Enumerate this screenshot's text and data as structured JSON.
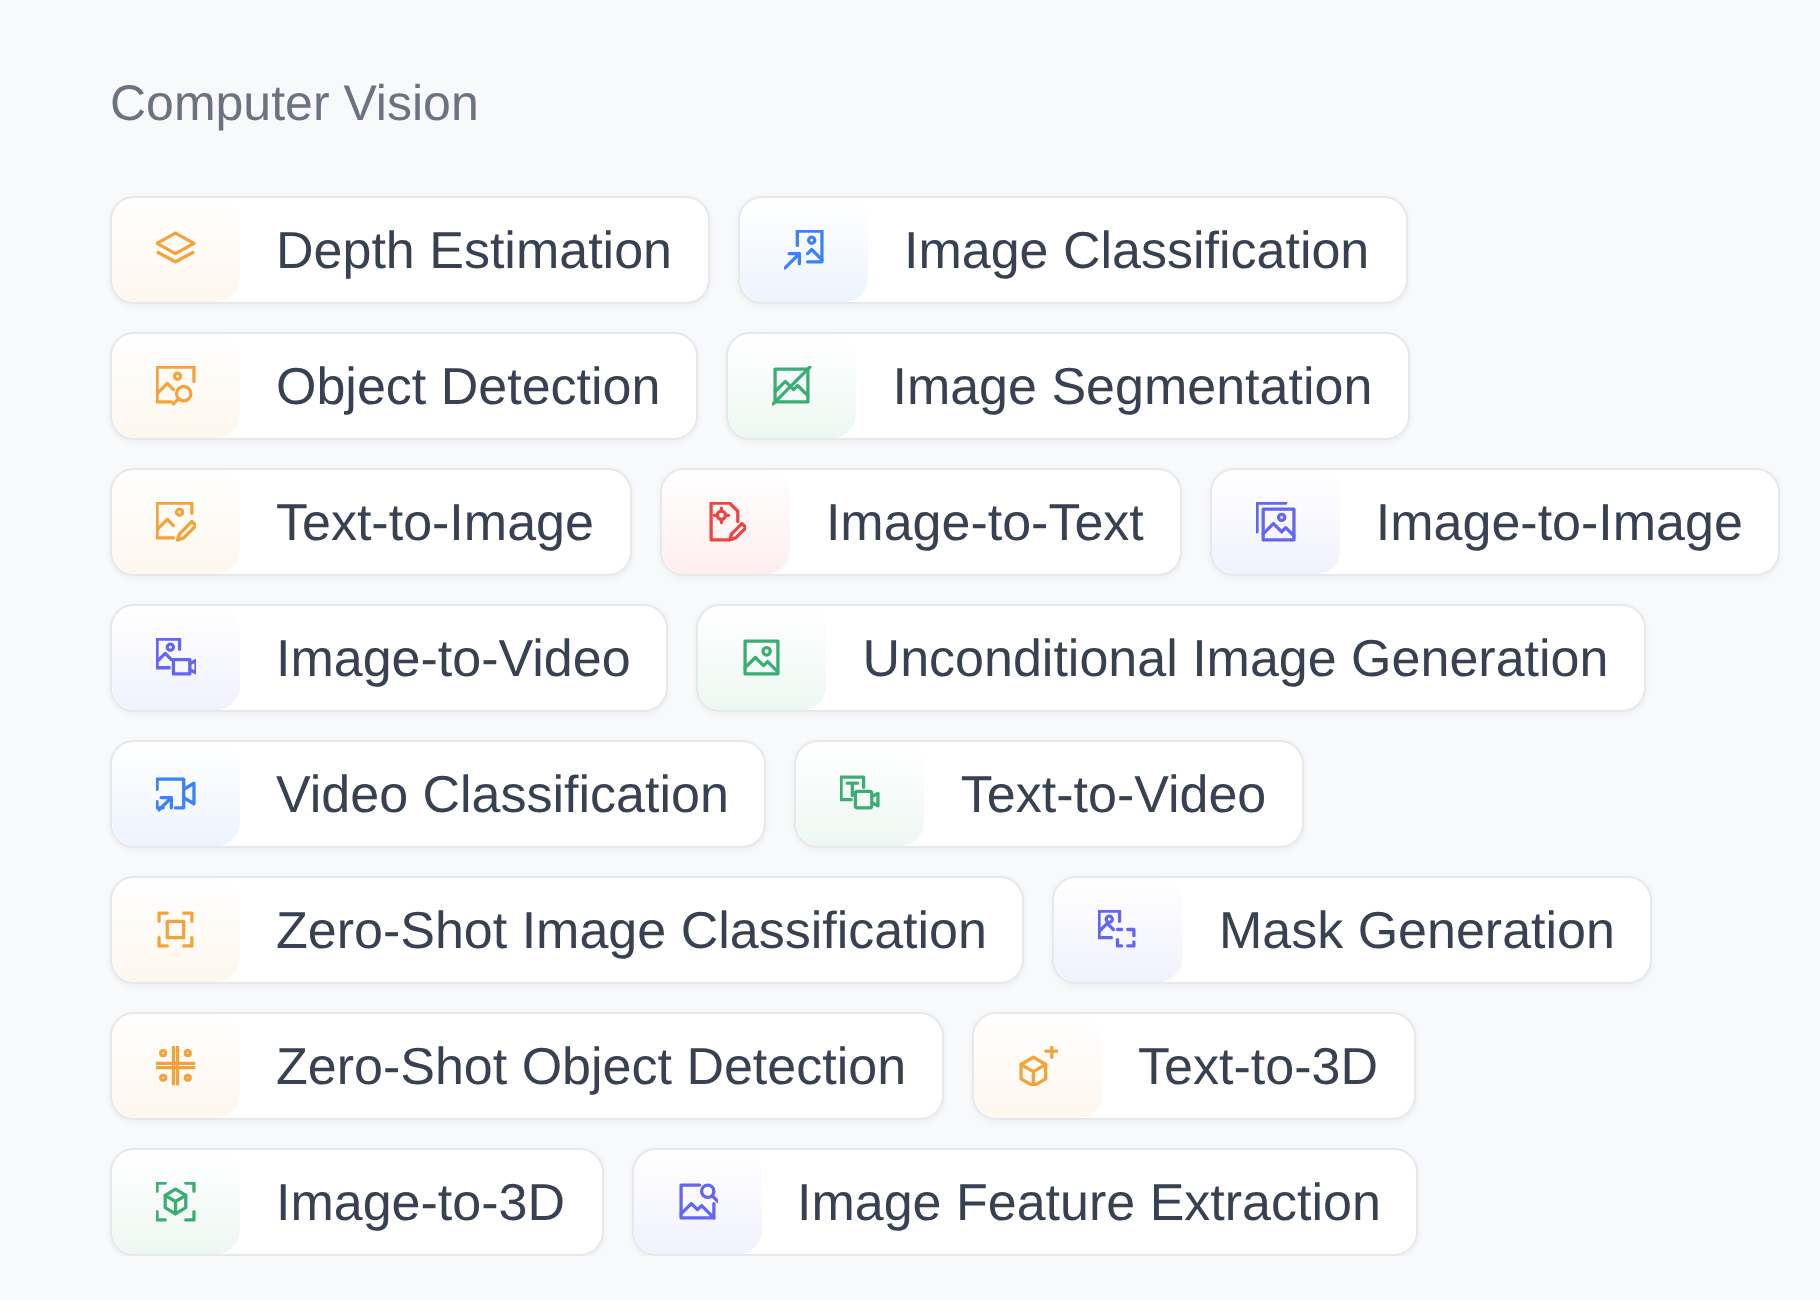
{
  "section": {
    "title": "Computer Vision",
    "tasks": [
      {
        "label": "Depth Estimation",
        "color": "#f2a33a"
      },
      {
        "label": "Image Classification",
        "color": "#3b82f6"
      },
      {
        "label": "Object Detection",
        "color": "#f2a33a"
      },
      {
        "label": "Image Segmentation",
        "color": "#3aae72"
      },
      {
        "label": "Text-to-Image",
        "color": "#f2a33a"
      },
      {
        "label": "Image-to-Text",
        "color": "#ef4444"
      },
      {
        "label": "Image-to-Image",
        "color": "#6366f1"
      },
      {
        "label": "Image-to-Video",
        "color": "#6366f1"
      },
      {
        "label": "Unconditional Image Generation",
        "color": "#3aae72"
      },
      {
        "label": "Video Classification",
        "color": "#3b82f6"
      },
      {
        "label": "Text-to-Video",
        "color": "#3aae72"
      },
      {
        "label": "Zero-Shot Image Classification",
        "color": "#f2a33a"
      },
      {
        "label": "Mask Generation",
        "color": "#6366f1"
      },
      {
        "label": "Zero-Shot Object Detection",
        "color": "#f2a33a"
      },
      {
        "label": "Text-to-3D",
        "color": "#f2a33a"
      },
      {
        "label": "Image-to-3D",
        "color": "#3aae72"
      },
      {
        "label": "Image Feature Extraction",
        "color": "#6366f1"
      }
    ]
  }
}
